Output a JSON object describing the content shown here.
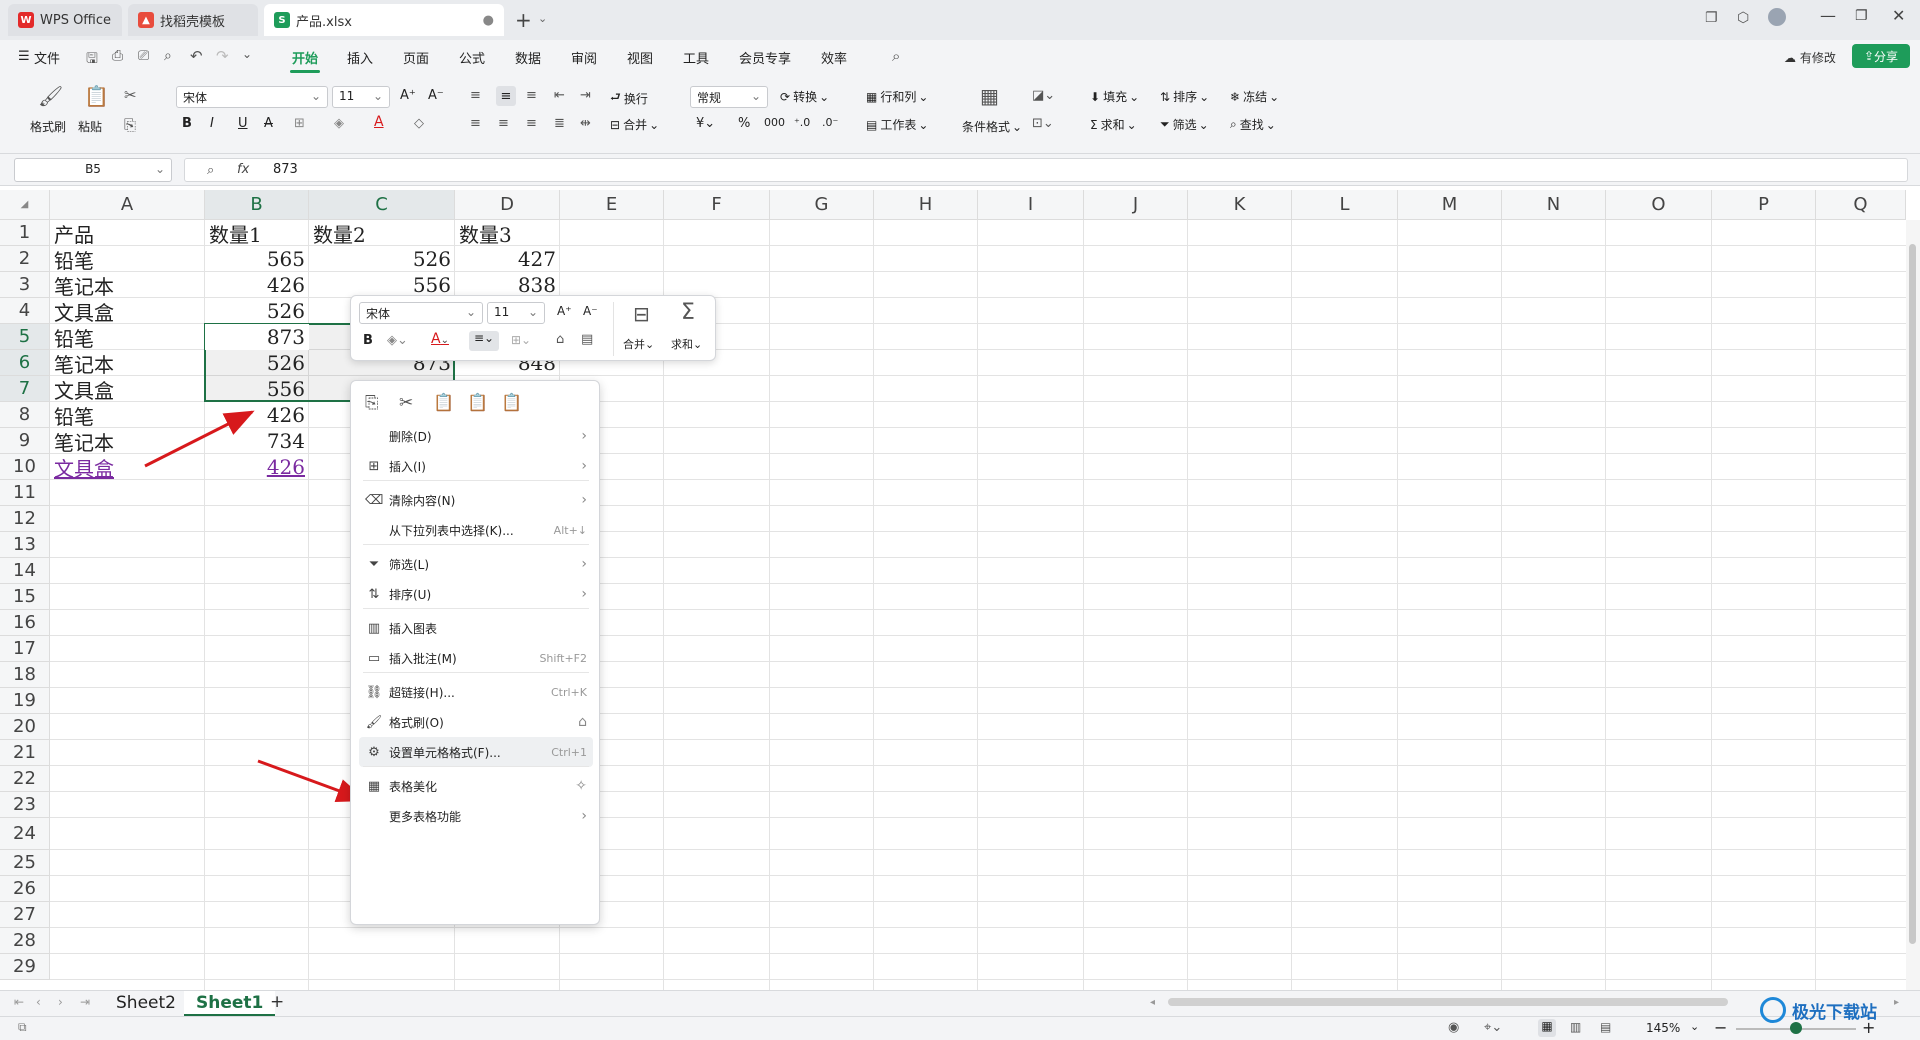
{
  "tabs": [
    {
      "label": "WPS Office",
      "icon": "wps-logo-icon"
    },
    {
      "label": "找稻壳模板",
      "icon": "docer-icon"
    },
    {
      "label": "产品.xlsx",
      "icon": "sheet-file-icon"
    }
  ],
  "colors": {
    "accent": "#1e9c5a",
    "selection": "#1e7145",
    "arrow": "#d7191c",
    "link": "#7a2aa0"
  },
  "menu": {
    "file": "文件",
    "items": [
      "开始",
      "插入",
      "页面",
      "公式",
      "数据",
      "审阅",
      "视图",
      "工具",
      "会员专享",
      "效率"
    ],
    "active": "开始",
    "modify": "有修改",
    "share": "分享"
  },
  "ribbon": {
    "format_painter": "格式刷",
    "paste": "粘贴",
    "font_name": "宋体",
    "font_size": "11",
    "wrap": "换行",
    "merge": "合并",
    "number_format": "常规",
    "convert": "转换",
    "rows_cols": "行和列",
    "worksheet": "工作表",
    "cond_format": "条件格式",
    "fill": "填充",
    "sort": "排序",
    "freeze": "冻结",
    "sum": "求和",
    "filter": "筛选",
    "find": "查找"
  },
  "formula": {
    "name_box": "B5",
    "fx": "fx",
    "value": "873"
  },
  "columns": [
    "A",
    "B",
    "C",
    "D",
    "E",
    "F",
    "G",
    "H",
    "I",
    "J",
    "K",
    "L",
    "M",
    "N",
    "O",
    "P",
    "Q"
  ],
  "rows": [
    "1",
    "2",
    "3",
    "4",
    "5",
    "6",
    "7",
    "8",
    "9",
    "10",
    "11",
    "12",
    "13",
    "14",
    "15",
    "16",
    "17",
    "18",
    "19",
    "20",
    "21",
    "22",
    "23",
    "24",
    "25",
    "26",
    "27",
    "28",
    "29"
  ],
  "cells": {
    "headers": [
      "产品",
      "数量1",
      "数量2",
      "数量3"
    ],
    "data": [
      [
        "铅笔",
        "565",
        "526",
        "427"
      ],
      [
        "笔记本",
        "426",
        "556",
        "838"
      ],
      [
        "文具盒",
        "526",
        "",
        ""
      ],
      [
        "铅笔",
        "873",
        "",
        ""
      ],
      [
        "笔记本",
        "526",
        "873",
        "848"
      ],
      [
        "文具盒",
        "556",
        "",
        ""
      ],
      [
        "铅笔",
        "426",
        "",
        ""
      ],
      [
        "笔记本",
        "734",
        "",
        ""
      ],
      [
        "文具盒",
        "426",
        "",
        ""
      ]
    ]
  },
  "mini_toolbar": {
    "font_name": "宋体",
    "font_size": "11",
    "bold": "B",
    "merge": "合并",
    "sum": "求和"
  },
  "context_menu": [
    {
      "label": "删除(D)",
      "icon": "",
      "shortcut": "",
      "submenu": true
    },
    {
      "label": "插入(I)",
      "icon": "insert-icon",
      "shortcut": "",
      "submenu": true
    },
    {
      "label": "清除内容(N)",
      "icon": "eraser-icon",
      "shortcut": "",
      "submenu": true
    },
    {
      "label": "从下拉列表中选择(K)...",
      "icon": "",
      "shortcut": "Alt+↓",
      "submenu": false
    },
    {
      "label": "筛选(L)",
      "icon": "filter-icon",
      "shortcut": "",
      "submenu": true
    },
    {
      "label": "排序(U)",
      "icon": "sort-icon",
      "shortcut": "",
      "submenu": true
    },
    {
      "label": "插入图表",
      "icon": "chart-icon",
      "shortcut": "",
      "submenu": false
    },
    {
      "label": "插入批注(M)",
      "icon": "comment-icon",
      "shortcut": "Shift+F2",
      "submenu": false
    },
    {
      "label": "超链接(H)...",
      "icon": "link-icon",
      "shortcut": "Ctrl+K",
      "submenu": false
    },
    {
      "label": "格式刷(O)",
      "icon": "format-painter-icon",
      "shortcut": "",
      "submenu": false
    },
    {
      "label": "设置单元格格式(F)...",
      "icon": "format-cells-icon",
      "shortcut": "Ctrl+1",
      "submenu": false
    },
    {
      "label": "表格美化",
      "icon": "table-style-icon",
      "shortcut": "",
      "submenu": false
    },
    {
      "label": "更多表格功能",
      "icon": "",
      "shortcut": "",
      "submenu": true
    }
  ],
  "sheets": [
    "Sheet2",
    "Sheet1"
  ],
  "active_sheet": "Sheet1",
  "zoom": "145%",
  "watermark": "极光下载站"
}
